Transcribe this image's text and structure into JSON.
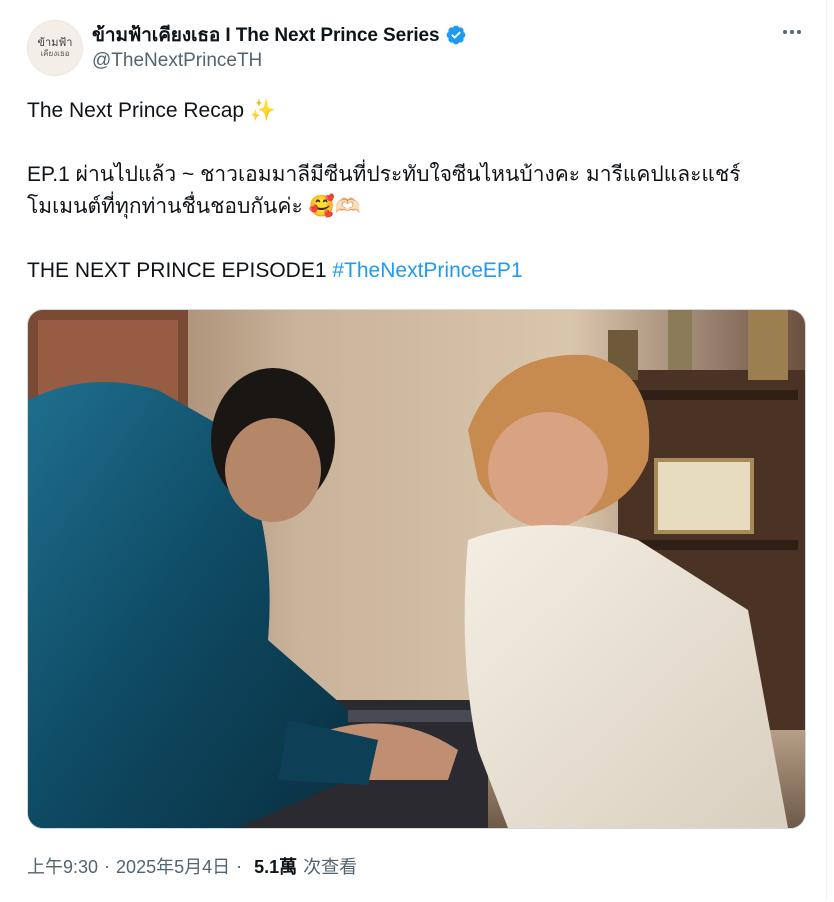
{
  "author": {
    "display_name": "ข้ามฟ้าเคียงเธอ I The Next Prince Series",
    "handle": "@TheNextPrinceTH",
    "avatar_line1": "ข้ามฟ้า",
    "avatar_line2": "เคียงเธอ",
    "verified_color": "#1d9bf0"
  },
  "tweet": {
    "line1": "The Next Prince Recap ✨",
    "line2": "EP.1 ผ่านไปแล้ว ~ ชาวเอมมาลีมีซีนที่ประทับใจซีนไหนบ้างคะ มารีแคปและแชร์",
    "line3": "โมเมนต์ที่ทุกท่านชื่นชอบกันค่ะ 🥰🫶🏻",
    "line4_text": "THE NEXT PRINCE EPISODE1 ",
    "hashtag": "#TheNextPrinceEP1"
  },
  "meta": {
    "time": "上午9:30",
    "date": "2025年5月4日",
    "separator": "·",
    "views_count": "5.1萬",
    "views_label": "次查看"
  },
  "icons": {
    "more": "more-horizontal-icon",
    "verified": "verified-badge-icon"
  },
  "colors": {
    "text": "#0f1419",
    "secondary": "#536471",
    "link": "#1d9bf0"
  }
}
